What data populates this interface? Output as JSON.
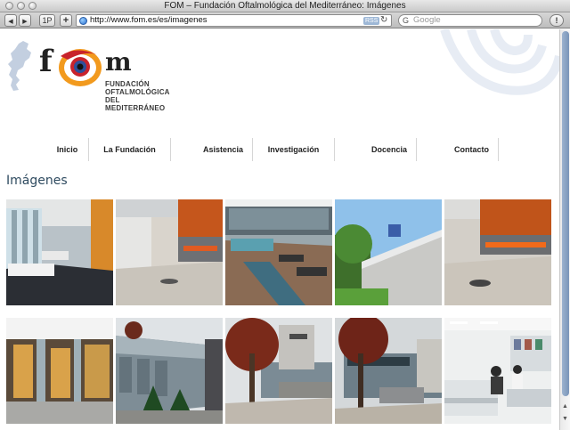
{
  "window": {
    "title": "FOM – Fundación Oftalmológica del Mediterráneo: Imágenes"
  },
  "toolbar": {
    "back": "◀",
    "forward": "▶",
    "history": "1P",
    "add": "+",
    "url": "http://www.fom.es/es/imagenes",
    "rss": "RSS",
    "reload": "↻",
    "search_icon": "G",
    "search_placeholder": "Google",
    "page_menu": "!"
  },
  "brand": {
    "letter_f": "f",
    "letter_m": "m",
    "line1": "FUNDACIÓN",
    "line2": "OFTALMOLÓGICA",
    "line3": "DEL MEDITERRÁNEO"
  },
  "nav": [
    {
      "label": "Inicio"
    },
    {
      "label": "La Fundación"
    },
    {
      "label": "Asistencia"
    },
    {
      "label": "Investigación"
    },
    {
      "label": "Docencia"
    },
    {
      "label": "Contacto"
    }
  ],
  "page": {
    "heading": "Imágenes"
  },
  "gallery": {
    "photos": [
      {
        "subject": "lobby-waiting-area"
      },
      {
        "subject": "reception-hall-orange-wall"
      },
      {
        "subject": "courtyard-pool-deck"
      },
      {
        "subject": "exterior-terrace-trees"
      },
      {
        "subject": "hall-orange-band"
      },
      {
        "subject": "glass-entrance-doors"
      },
      {
        "subject": "glass-facade-building"
      },
      {
        "subject": "street-tree-building"
      },
      {
        "subject": "building-entrance-tree"
      },
      {
        "subject": "office-workspace"
      }
    ]
  },
  "colors": {
    "heading": "#2f4b60",
    "accent_orange": "#f08a1c",
    "accent_blue": "#3a63a8"
  }
}
